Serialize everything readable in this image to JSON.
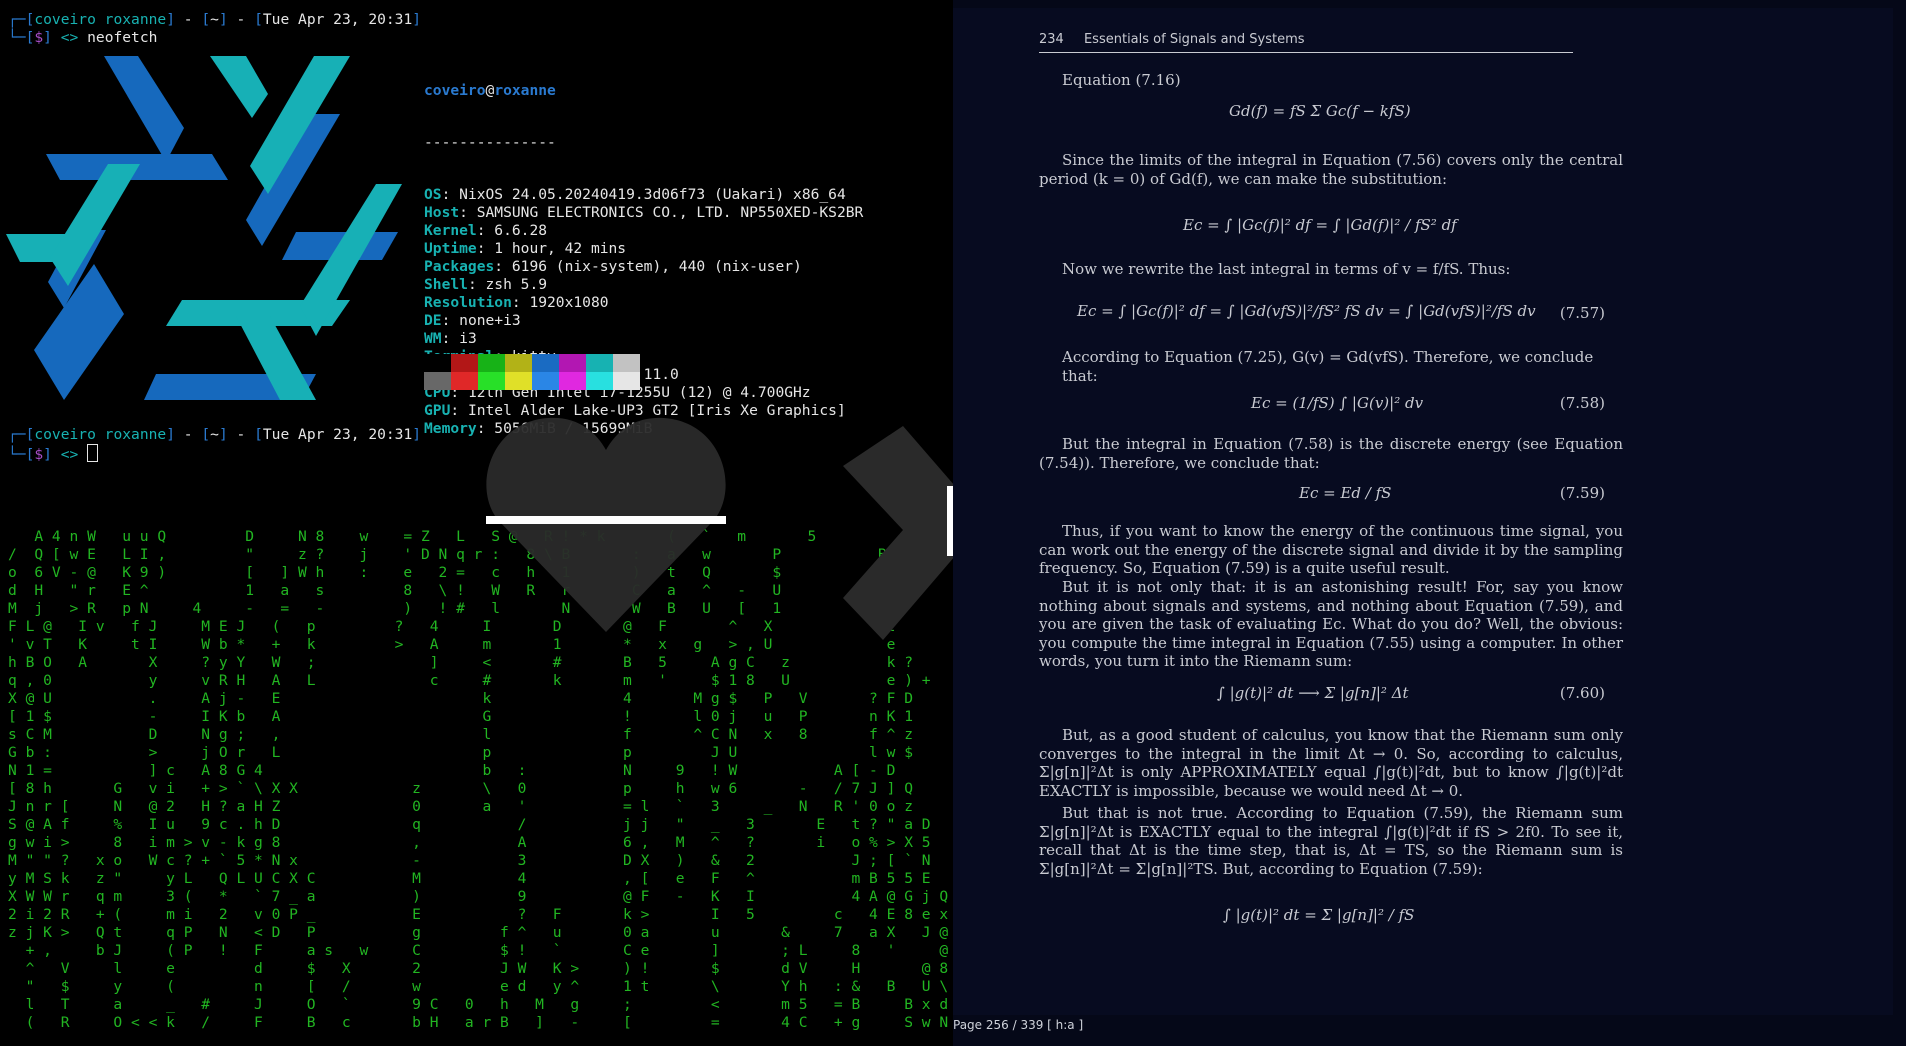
{
  "terminal": {
    "prompt1": {
      "user": "coveiro",
      "host": "roxanne",
      "dir": "~",
      "date": "Tue Apr 23, 20:31",
      "sym": "$",
      "arrow": "<>",
      "cmd": "neofetch"
    },
    "neofetch": {
      "user": "coveiro",
      "at": "@",
      "host": "roxanne",
      "sep": "---------------",
      "fields": [
        {
          "k": "OS",
          "v": "NixOS 24.05.20240419.3d06f73 (Uakari) x86_64"
        },
        {
          "k": "Host",
          "v": "SAMSUNG ELECTRONICS CO., LTD. NP550XED-KS2BR"
        },
        {
          "k": "Kernel",
          "v": "6.6.28"
        },
        {
          "k": "Uptime",
          "v": "1 hour, 42 mins"
        },
        {
          "k": "Packages",
          "v": "6196 (nix-system), 440 (nix-user)"
        },
        {
          "k": "Shell",
          "v": "zsh 5.9"
        },
        {
          "k": "Resolution",
          "v": "1920x1080"
        },
        {
          "k": "DE",
          "v": "none+i3"
        },
        {
          "k": "WM",
          "v": "i3"
        },
        {
          "k": "Terminal",
          "v": "kitty"
        },
        {
          "k": "Terminal Font",
          "v": "monospace 11.0"
        },
        {
          "k": "CPU",
          "v": "12th Gen Intel i7-1255U (12) @ 4.700GHz"
        },
        {
          "k": "GPU",
          "v": "Intel Alder Lake-UP3 GT2 [Iris Xe Graphics]"
        },
        {
          "k": "Memory",
          "v": "5056MiB / 15699MiB"
        }
      ],
      "colors_top": [
        "#000000",
        "#b21717",
        "#17b217",
        "#b2b217",
        "#1a6bc2",
        "#b217b2",
        "#17b2b2",
        "#c2c2c2"
      ],
      "colors_bottom": [
        "#686868",
        "#e02828",
        "#28e028",
        "#e0e028",
        "#2a86e6",
        "#e028e0",
        "#28e0e0",
        "#e6e6e6"
      ]
    },
    "prompt2": {
      "user": "coveiro",
      "host": "roxanne",
      "dir": "~",
      "date": "Tue Apr 23, 20:31",
      "sym": "$",
      "arrow": "<>"
    },
    "matrix_rows": [
      "   A 4 n W   u u Q         D     N 8    w    = Z   L   S @   R ! * k       (   `   m       5           h       O C",
      "/  Q [ w E   L I ,         \"     z ?    j    ' D N q r :   8 \\ B       :   a   w       P           B         M",
      "o  6 V - @   K 9 )         [   ] W h    :    e   2 =   c   h   1       )   t   Q       $           F         S",
      "d  H   \" r   E ^           1   a   s         8   \\ !   W   R   r       C   a   ^   -   U                     U",
      "M  j   > R   p N     4     -   =   -         )   ! #   l       N       W   B   U   [   1             F       w",
      "F L @   I v   f J     M E J   (   p         ?   4     I       D       @   F       ^   X             l",
      "' v T   K     t I     W b *   +   k         >   A     m       1       *   x   g   > , U             e",
      "h B O   A       X     ? y Y   W   ;             ]     <       #       B   5     A g C   z           k ?",
      "q , 0           y     v R H   A   L             c     #       k       m   '     $ 1 8   U           e ) +",
      "X @ U           .     A j -   E                       k               4       M g $   P   V       ? F D",
      "[ 1 $           -     I K b   A                       G               !       l 0 j   u   P       n K 1",
      "s C M           D     N g ;   ,                       l               f       ^ C N   x   8       f ^ z",
      "G b :           >     j O r   L                       p               p         J U               l w $",
      "N 1 =           ] c   A 8 G 4                         b   :           N     9   ! W           A [ - D",
      "[ 8 h       G   v i   + > ` \\ X X             z       \\   0           p     h   w 6       -   / 7 J ] Q",
      "J n r [     N   @ 2   H ? a H Z               0       a   '           = l   `   3     _   N   R ' 0 o z",
      "S @ A f     %   I u   9 c . h D               q           /           j j   \"   _   3       E   t ? \" a D",
      "g w i >     8   i m > v - k g 8               ,           A           6 ,   M   ^   ?       i   o % > X 5",
      "M \" \" ?   x o   W c ? + ` 5 * N x             -           3           D X   )   &   2           J ; [ ` N",
      "y M S k   z \"     y L   Q L U C X C           M           4           , [   e   F   ^           m B 5 5 E",
      "X W W r   q m     3 (   *   ` 7 _ a           )           9           @ F   -   K   I           4 A @ G j Q",
      "2 i 2 R   + (     m i   2   v 0 P _           E           ?   F       k >       I   5         c   4 E 8 e x",
      "z j K >   Q t     q P   N   < D   P           g         f ^   u       0 a       u       &     7   a X   J @",
      "  + ,     b J     ( P   !   F     a s   w     C         $ !   `       C e       ]       ; L     8   '     @ L",
      "  ^   V     l     e         d     $   X       2         J W   K >     ) !       $       d V     H       @ 8",
      "  \"   $     y     (         n     [   /       w         e d   y ^     1 t       \\       Y h   : &   B   U \\",
      "  l   T     a     _   #     J     O   `       9 C   0   h   M   g     ;         <       m 5   = B     B x d",
      "  (   R     O < < k   /     F     B   c       b H   a r B   ]   -     [         =       4 C   + g     S w N"
    ]
  },
  "pdf": {
    "page_number": "234",
    "running_title": "Essentials of Signals and Systems",
    "status_bar": "Page 256 / 339 [ h:a ]",
    "paragraphs": [
      "Equation (7.16)",
      "Since the limits of the integral in Equation (7.56) covers only the central period (k = 0) of Gd(f), we can make the substitution:",
      "Now we rewrite the last integral in terms of v = f/fS. Thus:",
      "According to Equation (7.25), G(v) = Gd(vfS). Therefore, we conclude that:",
      "But the integral in Equation (7.58) is the discrete energy (see Equation (7.54)). Therefore, we conclude that:",
      "Thus, if you want to know the energy of the continuous time signal, you can work out the energy of the discrete signal and divide it by the sampling frequency. So, Equation (7.59) is a quite useful result.",
      "But it is not only that: it is an astonishing result! For, say you know nothing about signals and systems, and nothing about Equation (7.59), and you are given the task of evaluating Ec. What do you do? Well, the obvious: you compute the time integral in Equation (7.55) using a computer. In other words, you turn it into the Riemann sum:",
      "But, as a good student of calculus, you know that the Riemann sum only converges to the integral in the limit Δt → 0. So, according to calculus, Σ|g[n]|²Δt is only APPROXIMATELY equal ∫|g(t)|²dt, but to know ∫|g(t)|²dt EXACTLY is impossible, because we would need Δt → 0.",
      "But that is not true. According to Equation (7.59), the Riemann sum Σ|g[n]|²Δt is EXACTLY equal to the integral ∫|g(t)|²dt if fS > 2f0. To see it, recall that Δt is the time step, that is, Δt = TS, so the Riemann sum is Σ|g[n]|²Δt = Σ|g[n]|²TS. But, according to Equation (7.59):"
    ],
    "equations": [
      {
        "expr": "Gd(f) = fS Σ Gc(f − kfS)",
        "num": ""
      },
      {
        "expr": "Ec = ∫ |Gc(f)|² df = ∫ |Gd(f)|² / fS² df",
        "num": ""
      },
      {
        "expr": "Ec = ∫ |Gc(f)|² df = ∫ |Gd(vfS)|²/fS² fS dv = ∫ |Gd(vfS)|²/fS dv",
        "num": "(7.57)"
      },
      {
        "expr": "Ec = (1/fS) ∫ |G(v)|² dv",
        "num": "(7.58)"
      },
      {
        "expr": "Ec = Ed / fS",
        "num": "(7.59)"
      },
      {
        "expr": "∫ |g(t)|² dt ⟶ Σ |g[n]|² Δt",
        "num": "(7.60)"
      },
      {
        "expr": "∫ |g(t)|² dt = Σ |g[n]|² / fS",
        "num": ""
      }
    ]
  }
}
